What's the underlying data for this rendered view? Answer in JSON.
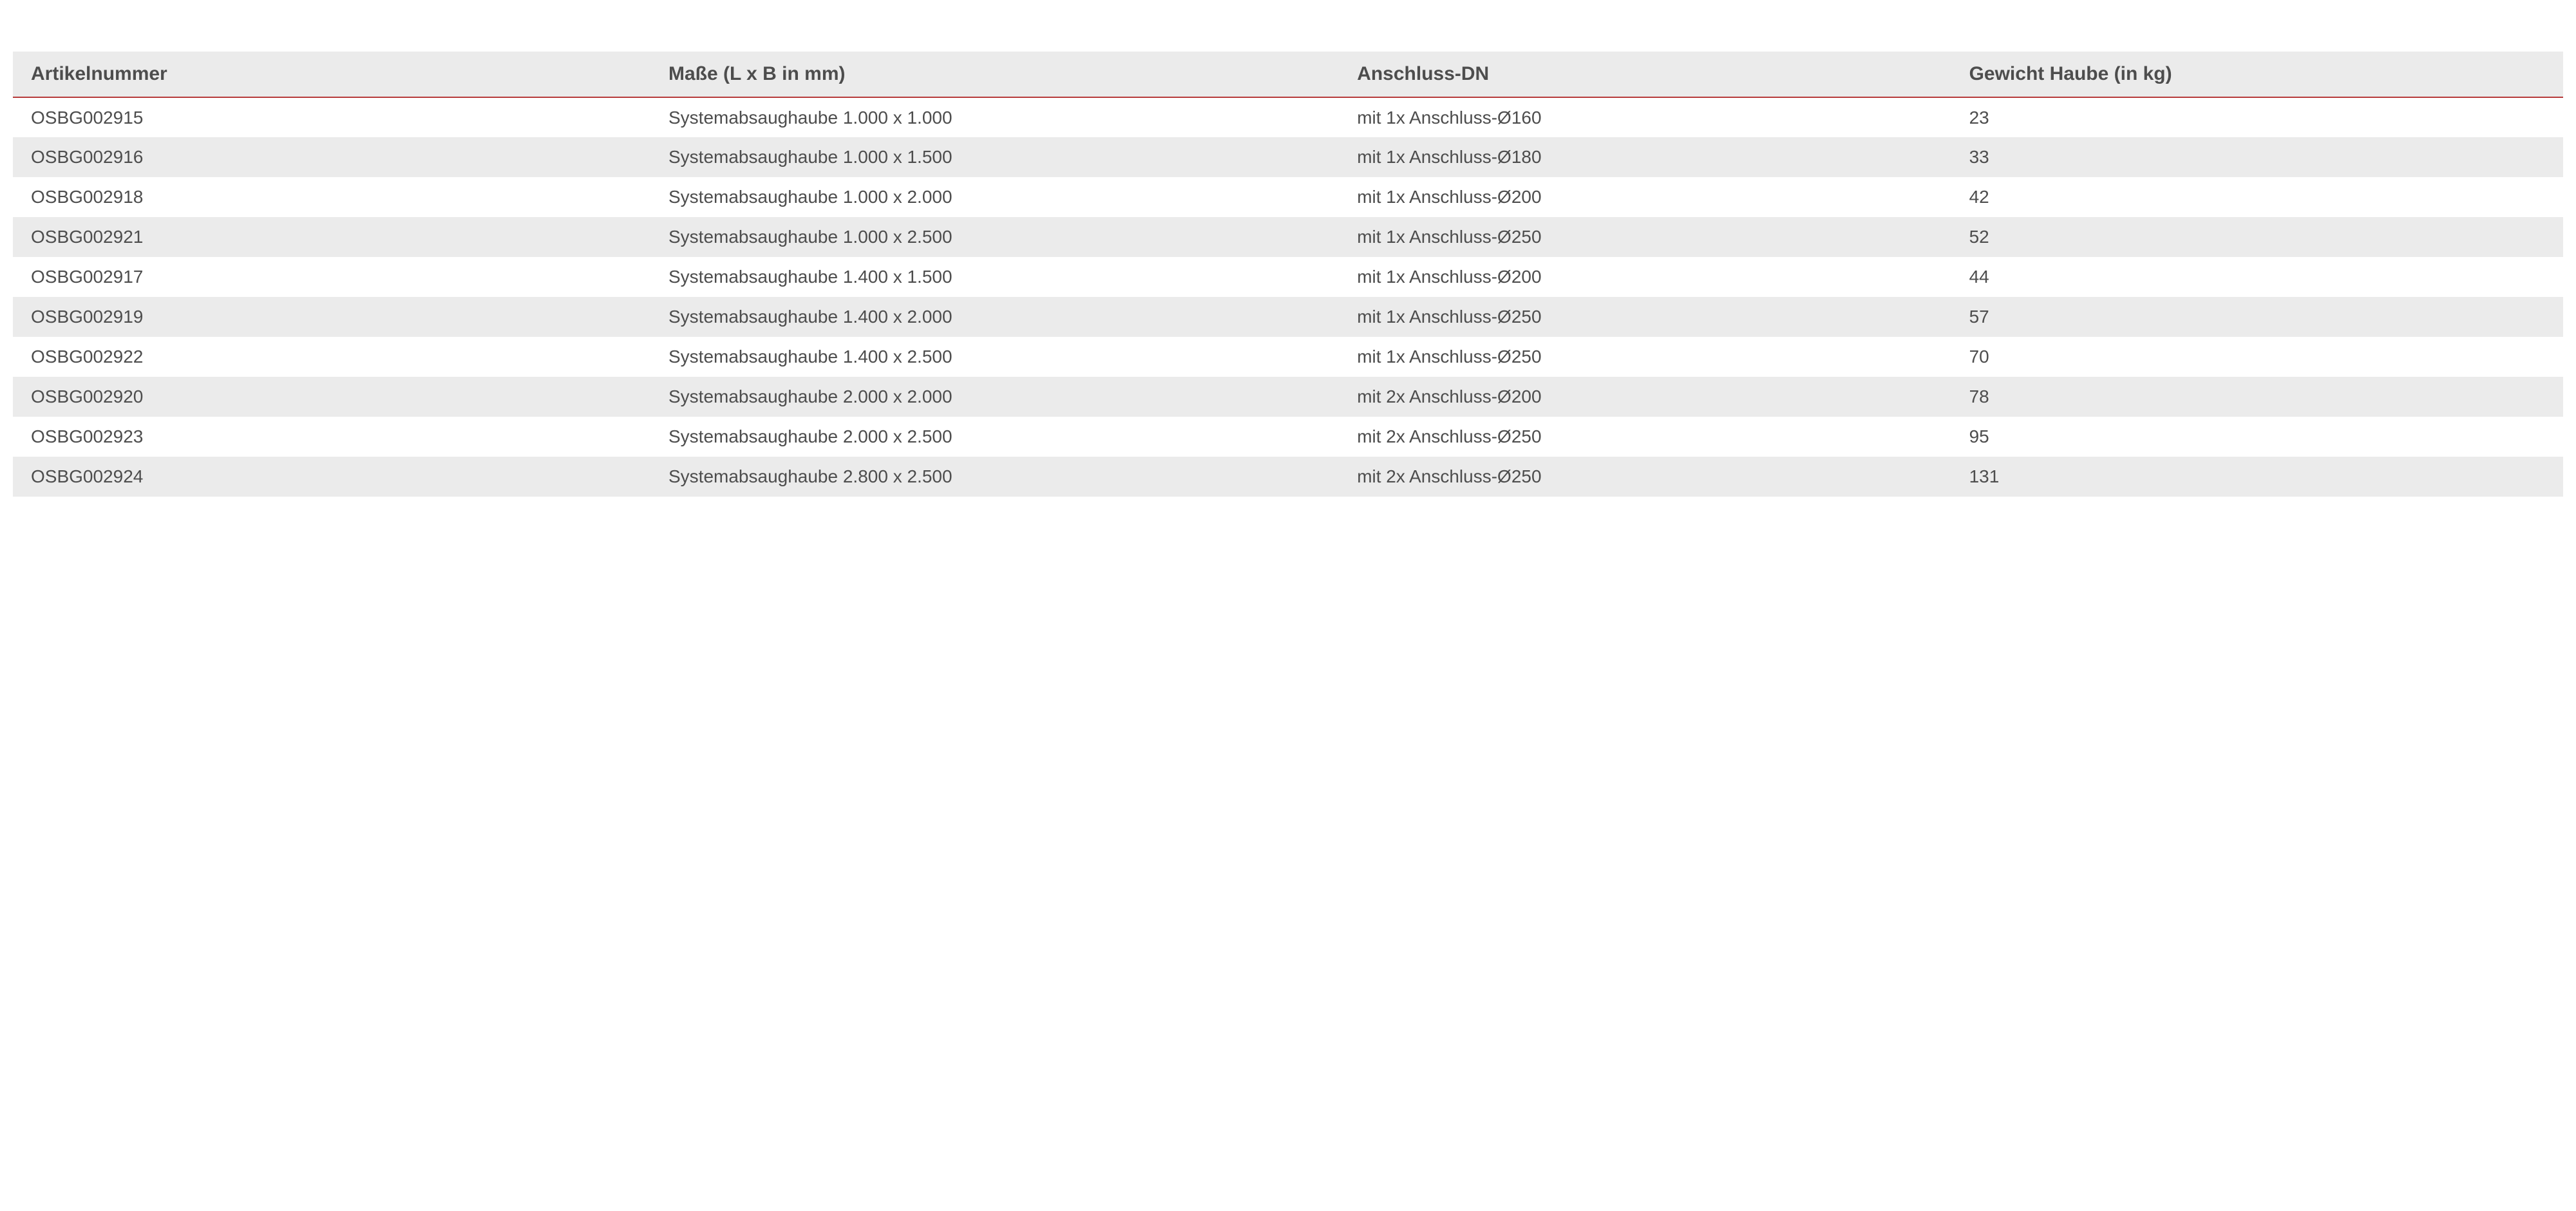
{
  "table": {
    "headers": [
      "Artikelnummer",
      "Maße (L x B in mm)",
      "Anschluss-DN",
      "Gewicht Haube (in kg)"
    ],
    "rows": [
      {
        "artikelnummer": "OSBG002915",
        "masse": "Systemabsaughaube 1.000 x 1.000",
        "anschluss": "mit 1x Anschluss-Ø160",
        "gewicht": "23"
      },
      {
        "artikelnummer": "OSBG002916",
        "masse": "Systemabsaughaube 1.000 x 1.500",
        "anschluss": "mit 1x Anschluss-Ø180",
        "gewicht": "33"
      },
      {
        "artikelnummer": "OSBG002918",
        "masse": "Systemabsaughaube 1.000 x 2.000",
        "anschluss": "mit 1x Anschluss-Ø200",
        "gewicht": "42"
      },
      {
        "artikelnummer": "OSBG002921",
        "masse": "Systemabsaughaube 1.000 x 2.500",
        "anschluss": "mit 1x Anschluss-Ø250",
        "gewicht": "52"
      },
      {
        "artikelnummer": "OSBG002917",
        "masse": "Systemabsaughaube 1.400 x 1.500",
        "anschluss": "mit 1x Anschluss-Ø200",
        "gewicht": "44"
      },
      {
        "artikelnummer": "OSBG002919",
        "masse": "Systemabsaughaube 1.400 x 2.000",
        "anschluss": "mit 1x Anschluss-Ø250",
        "gewicht": "57"
      },
      {
        "artikelnummer": "OSBG002922",
        "masse": "Systemabsaughaube 1.400 x 2.500",
        "anschluss": "mit 1x Anschluss-Ø250",
        "gewicht": "70"
      },
      {
        "artikelnummer": "OSBG002920",
        "masse": "Systemabsaughaube 2.000 x 2.000",
        "anschluss": "mit 2x Anschluss-Ø200",
        "gewicht": "78"
      },
      {
        "artikelnummer": "OSBG002923",
        "masse": "Systemabsaughaube 2.000 x 2.500",
        "anschluss": "mit 2x Anschluss-Ø250",
        "gewicht": "95"
      },
      {
        "artikelnummer": "OSBG002924",
        "masse": "Systemabsaughaube 2.800 x 2.500",
        "anschluss": "mit 2x Anschluss-Ø250",
        "gewicht": "131"
      }
    ]
  }
}
